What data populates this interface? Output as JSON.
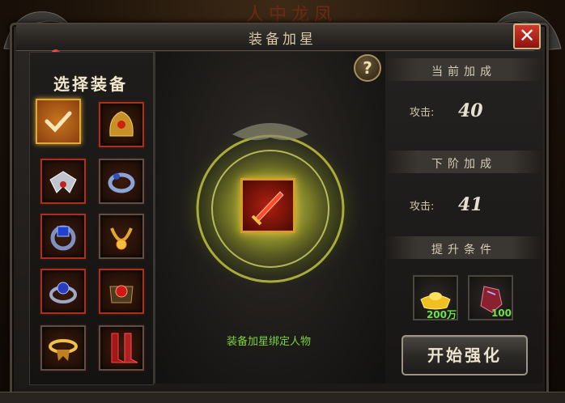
{
  "background_title": "人中龙凤",
  "window": {
    "title": "装备加星",
    "close_label": "✕"
  },
  "left_panel": {
    "title": "选择装备",
    "slots": [
      {
        "item": "selected-checkmark",
        "selected": true
      },
      {
        "item": "golden-helmet"
      },
      {
        "item": "winged-amulet"
      },
      {
        "item": "bracelet-blue"
      },
      {
        "item": "blue-gem-ring"
      },
      {
        "item": "golden-dragon-necklace"
      },
      {
        "item": "sapphire-ring"
      },
      {
        "item": "ruby-belt"
      },
      {
        "item": "gold-ring"
      },
      {
        "item": "crimson-boots"
      }
    ]
  },
  "center": {
    "help_label": "?",
    "bind_notice": "装备加星绑定人物"
  },
  "right_panel": {
    "current_bonus_title": "当前加成",
    "current_attack_label": "攻击:",
    "current_attack_value": "40",
    "next_bonus_title": "下阶加成",
    "next_attack_label": "攻击:",
    "next_attack_value": "41",
    "requirement_title": "提升条件",
    "materials": [
      {
        "icon": "gold-ingot-icon",
        "count": "200万"
      },
      {
        "icon": "red-stone-icon",
        "count": "100"
      }
    ],
    "start_button": "开始强化"
  },
  "colors": {
    "accent_green": "#6ee04a",
    "slot_border": "#a8301e",
    "selected": "#e0a834"
  }
}
